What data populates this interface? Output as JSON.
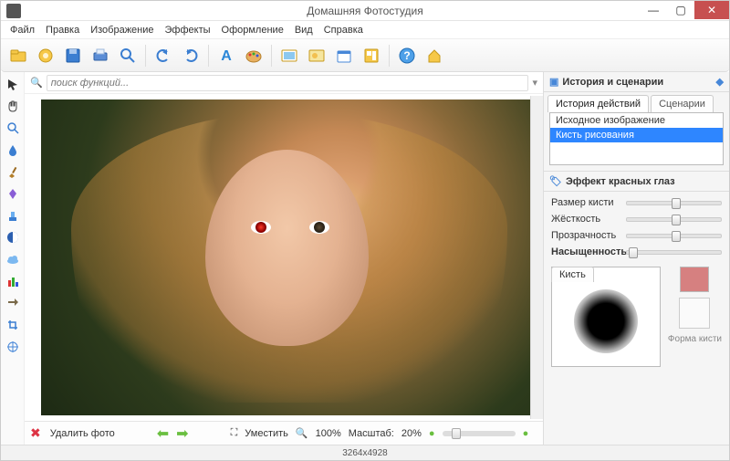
{
  "window": {
    "title": "Домашняя Фотостудия"
  },
  "menu": [
    "Файл",
    "Правка",
    "Изображение",
    "Эффекты",
    "Оформление",
    "Вид",
    "Справка"
  ],
  "search": {
    "placeholder": "поиск функций..."
  },
  "bottom": {
    "delete": "Удалить фото",
    "fit": "Уместить",
    "hundred": "100%",
    "scale_label": "Масштаб:",
    "scale_value": "20%"
  },
  "status": {
    "dims": "3264x4928"
  },
  "panel": {
    "title": "История и сценарии",
    "tabs": {
      "history": "История действий",
      "scenarios": "Сценарии"
    },
    "history_rows": [
      "Исходное изображение",
      "Кисть рисования"
    ],
    "history_selected": 1
  },
  "effect": {
    "title": "Эффект красных глаз",
    "sliders": {
      "size": "Размер кисти",
      "hardness": "Жёсткость",
      "opacity": "Прозрачность",
      "saturation": "Насыщенность"
    },
    "brush_tab": "Кисть",
    "shape_label": "Форма\nкисти"
  }
}
